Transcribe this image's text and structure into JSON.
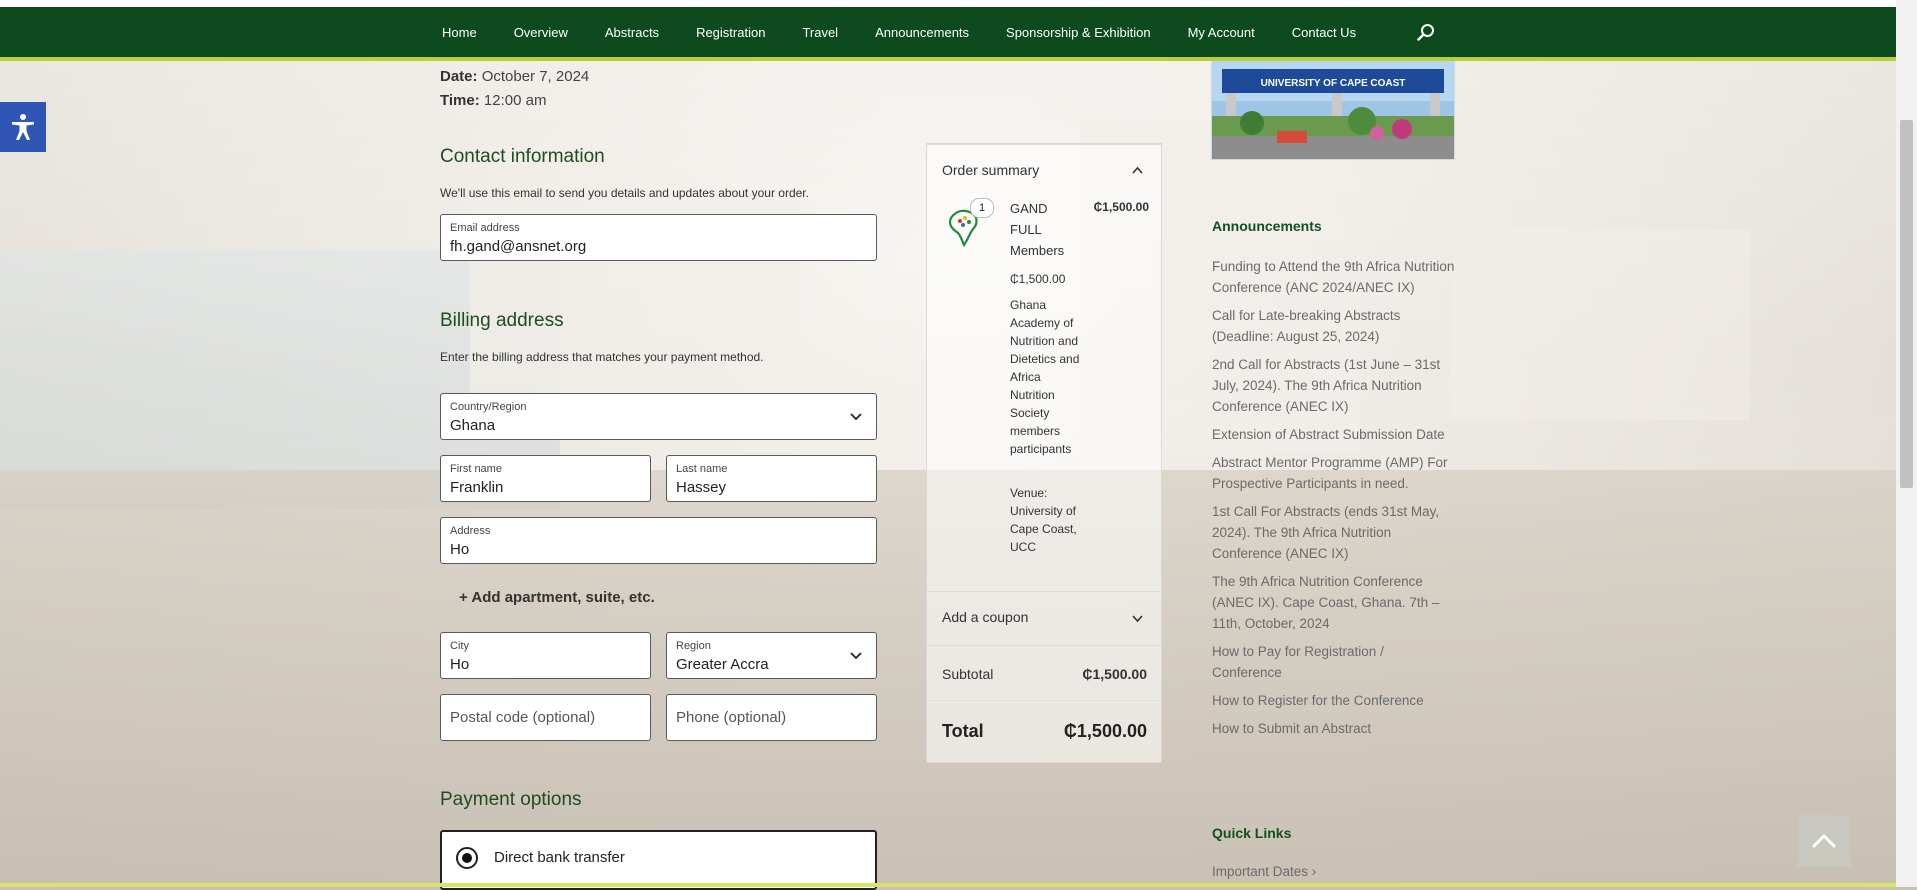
{
  "nav": {
    "items": [
      "Home",
      "Overview",
      "Abstracts",
      "Registration",
      "Travel",
      "Announcements",
      "Sponsorship & Exhibition",
      "My Account",
      "Contact Us"
    ],
    "search_icon": "search-icon"
  },
  "event": {
    "date_label": "Date:",
    "date_value": "October 7, 2024",
    "time_label": "Time:",
    "time_value": "12:00 am"
  },
  "contact": {
    "heading": "Contact information",
    "description": "We'll use this email to send you details and updates about your order.",
    "email_label": "Email address",
    "email_value": "fh.gand@ansnet.org"
  },
  "billing": {
    "heading": "Billing address",
    "description": "Enter the billing address that matches your payment method.",
    "country_label": "Country/Region",
    "country_value": "Ghana",
    "first_name_label": "First name",
    "first_name_value": "Franklin",
    "last_name_label": "Last name",
    "last_name_value": "Hassey",
    "address_label": "Address",
    "address_value": "Ho",
    "add_apartment": "+ Add apartment, suite, etc.",
    "city_label": "City",
    "city_value": "Ho",
    "region_label": "Region",
    "region_value": "Greater Accra",
    "postal_placeholder": "Postal code (optional)",
    "phone_placeholder": "Phone (optional)"
  },
  "payment": {
    "heading": "Payment options",
    "option": "Direct bank transfer"
  },
  "order": {
    "heading": "Order summary",
    "quantity": "1",
    "product_name": "GAND FULL Members",
    "product_price": "₵1,500.00",
    "unit_price": "₵1,500.00",
    "product_description": "Ghana Academy of Nutrition and Dietetics and Africa Nutrition Society members participants",
    "venue": "Venue: University of Cape Coast, UCC",
    "coupon": "Add a coupon",
    "subtotal_label": "Subtotal",
    "subtotal_value": "₵1,500.00",
    "total_label": "Total",
    "total_value": "₵1,500.00"
  },
  "sidebar": {
    "image_caption": "UNIVERSITY OF CAPE COAST",
    "announcements_heading": "Announcements",
    "announcements": [
      "Funding to Attend the 9th Africa Nutrition Conference (ANC 2024/ANEC IX)",
      "Call for Late-breaking Abstracts (Deadline: August 25, 2024)",
      "2nd Call for Abstracts (1st June – 31st July, 2024). The 9th Africa Nutrition Conference (ANEC IX)",
      "Extension of Abstract Submission Date",
      "Abstract Mentor Programme (AMP) For Prospective Participants in need.",
      "1st Call For Abstracts (ends 31st May, 2024). The 9th Africa Nutrition Conference (ANEC IX)",
      "The 9th Africa Nutrition Conference (ANEC IX). Cape Coast, Ghana. 7th – 11th, October, 2024",
      "How to Pay for Registration / Conference",
      "How to Register for the Conference",
      "How to Submit an Abstract"
    ],
    "quick_links_heading": "Quick Links",
    "quick_links": [
      "Important Dates ›"
    ]
  },
  "colors": {
    "nav_bg": "#0d4a1e",
    "nav_accent": "#b8cf3a",
    "heading": "#1f4d23",
    "accessibility": "#2f56b5"
  }
}
